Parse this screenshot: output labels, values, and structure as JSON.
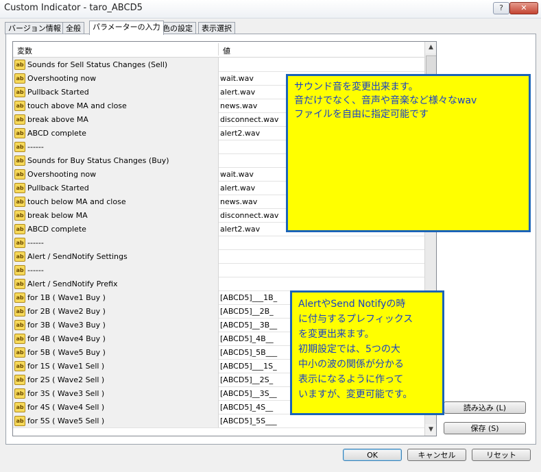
{
  "window": {
    "title": "Custom Indicator - taro_ABCD5",
    "help_btn": "?",
    "close_btn": "✕"
  },
  "tabs": [
    {
      "label": "バージョン情報"
    },
    {
      "label": "全般"
    },
    {
      "label": "パラメーターの入力"
    },
    {
      "label": "色の設定"
    },
    {
      "label": "表示選択"
    }
  ],
  "grid": {
    "col_variable": "変数",
    "col_value": "値",
    "icon_text": "ab",
    "rows": [
      {
        "name": "Sounds for Sell Status Changes (Sell)",
        "value": ""
      },
      {
        "name": "Overshooting now",
        "value": "wait.wav"
      },
      {
        "name": "Pullback Started",
        "value": "alert.wav"
      },
      {
        "name": "touch above MA and close",
        "value": "news.wav"
      },
      {
        "name": "break above MA",
        "value": "disconnect.wav"
      },
      {
        "name": "ABCD complete",
        "value": "alert2.wav"
      },
      {
        "name": "------",
        "value": ""
      },
      {
        "name": "Sounds for Buy Status Changes (Buy)",
        "value": ""
      },
      {
        "name": "Overshooting now",
        "value": "wait.wav"
      },
      {
        "name": "Pullback Started",
        "value": "alert.wav"
      },
      {
        "name": "touch below MA and close",
        "value": "news.wav"
      },
      {
        "name": "break below MA",
        "value": "disconnect.wav"
      },
      {
        "name": "ABCD complete",
        "value": "alert2.wav"
      },
      {
        "name": "------",
        "value": ""
      },
      {
        "name": "Alert / SendNotify Settings",
        "value": ""
      },
      {
        "name": "------",
        "value": ""
      },
      {
        "name": "Alert / SendNotify Prefix",
        "value": ""
      },
      {
        "name": "for 1B ( Wave1 Buy )",
        "value": "[ABCD5]___1B_"
      },
      {
        "name": "for 2B ( Wave2 Buy )",
        "value": "[ABCD5]__2B_"
      },
      {
        "name": "for 3B ( Wave3 Buy )",
        "value": "[ABCD5]__3B__"
      },
      {
        "name": "for 4B ( Wave4 Buy )",
        "value": "[ABCD5]_4B__"
      },
      {
        "name": "for 5B ( Wave5 Buy )",
        "value": "[ABCD5]_5B___"
      },
      {
        "name": "for 1S ( Wave1 Sell )",
        "value": "[ABCD5]___1S_"
      },
      {
        "name": "for 2S ( Wave2 Sell )",
        "value": "[ABCD5]__2S_"
      },
      {
        "name": "for 3S ( Wave3 Sell )",
        "value": "[ABCD5]__3S__"
      },
      {
        "name": "for 4S ( Wave4 Sell )",
        "value": "[ABCD5]_4S__"
      },
      {
        "name": "for 5S ( Wave5 Sell )",
        "value": "[ABCD5]_5S___"
      }
    ]
  },
  "buttons": {
    "load": "読み込み (L)",
    "save": "保存 (S)",
    "ok": "OK",
    "cancel": "キャンセル",
    "reset": "リセット"
  },
  "annotations": {
    "sound": [
      "サウンド音を変更出来ます。",
      "音だけでなく、音声や音楽など様々なwav",
      "ファイルを自由に指定可能です"
    ],
    "prefix": [
      "AlertやSend Notifyの時",
      "に付与するプレフィックス",
      "を変更出来ます。",
      "初期設定では、5つの大",
      "中小の波の関係が分かる",
      "表示になるように作って",
      "いますが、変更可能です。"
    ]
  },
  "colors": {
    "note_bg": "#ffff00",
    "note_border": "#1a63b8",
    "note_text": "#1840c8"
  }
}
